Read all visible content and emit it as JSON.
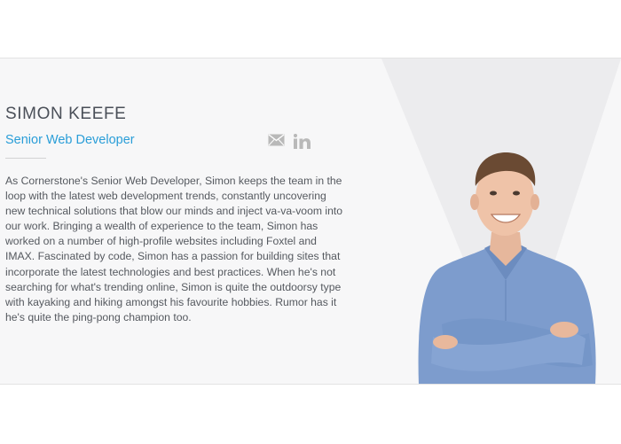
{
  "profile": {
    "name": "SIMON KEEFE",
    "role": "Senior Web Developer",
    "bio": "As Cornerstone's Senior Web Developer, Simon keeps the team in the loop with the latest web development trends, constantly uncovering new technical solutions that blow our minds and inject va-va-voom into our work. Bringing a wealth of experience to the team, Simon has worked on a number of high-profile websites including Foxtel and IMAX. Fascinated by code, Simon has a passion for building sites that incorporate the latest technologies and best practices. When he's not searching for what's trending online, Simon is quite the outdoorsy type with kayaking and hiking amongst his favourite hobbies. Rumor has it he's quite the ping-pong champion too."
  },
  "social": {
    "email_icon": "envelope-icon",
    "linkedin_icon": "linkedin-icon"
  },
  "colors": {
    "name": "#4a4f58",
    "role_accent": "#2a9ed8",
    "body_text": "#55595f",
    "icon": "#b9b9b9",
    "shirt": "#7d9ccd"
  }
}
